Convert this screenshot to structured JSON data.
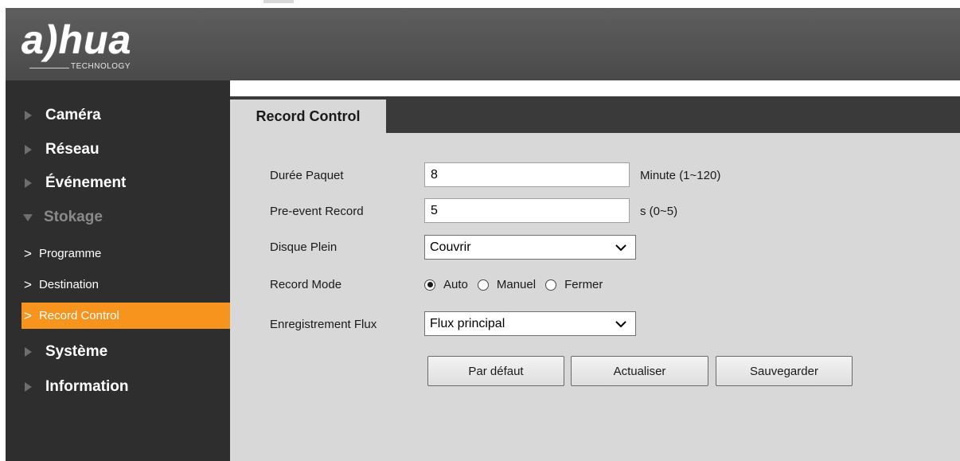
{
  "brand": {
    "logo_text": "a)hua",
    "logo_sub": "TECHNOLOGY"
  },
  "sidebar": {
    "items": [
      {
        "label": "Caméra"
      },
      {
        "label": "Réseau"
      },
      {
        "label": "Événement"
      },
      {
        "label": "Stokage"
      },
      {
        "label": "Système"
      },
      {
        "label": "Information"
      }
    ],
    "sub_items": [
      {
        "label": "Programme"
      },
      {
        "label": "Destination"
      },
      {
        "label": "Record Control"
      }
    ]
  },
  "tab": {
    "label": "Record Control"
  },
  "form": {
    "duree_paquet": {
      "label": "Durée Paquet",
      "value": "8",
      "unit": "Minute (1~120)"
    },
    "pre_event": {
      "label": "Pre-event Record",
      "value": "5",
      "unit": "s (0~5)"
    },
    "disque_plein": {
      "label": "Disque Plein",
      "value": "Couvrir"
    },
    "record_mode": {
      "label": "Record Mode",
      "options": [
        "Auto",
        "Manuel",
        "Fermer"
      ],
      "selected": "Auto"
    },
    "flux": {
      "label": "Enregistrement Flux",
      "value": "Flux principal"
    }
  },
  "buttons": {
    "default": "Par défaut",
    "refresh": "Actualiser",
    "save": "Sauvegarder"
  },
  "colors": {
    "accent": "#f7941d",
    "sidebar_bg": "#2e2e2e",
    "content_bg": "#d8d8d8"
  }
}
